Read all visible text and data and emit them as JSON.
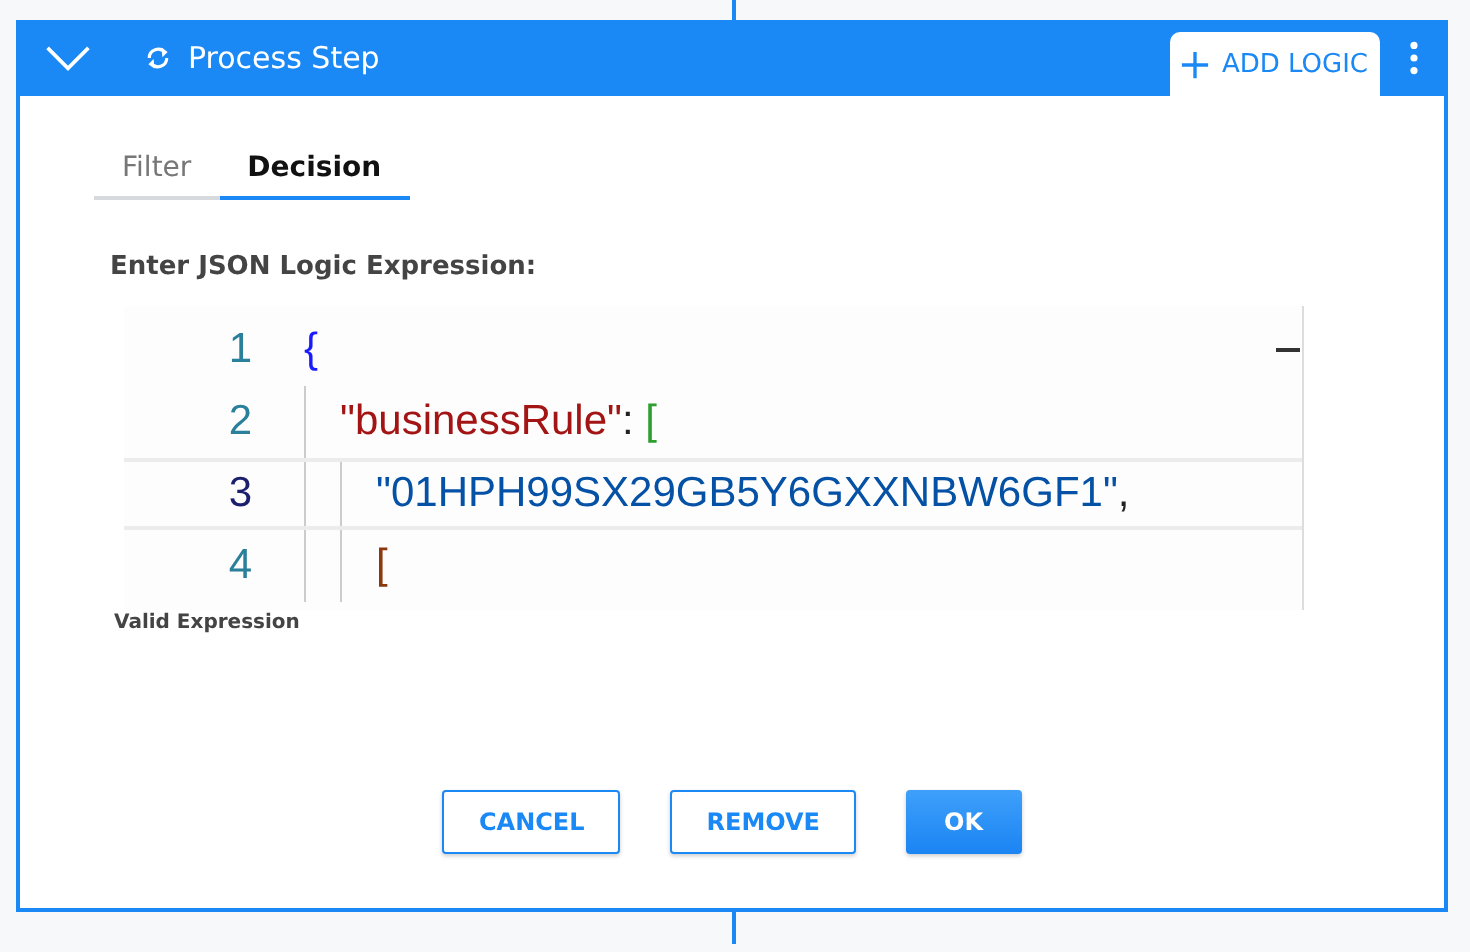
{
  "header": {
    "title": "Process Step",
    "expanded": true,
    "action": "ADD LOGIC"
  },
  "tabs": [
    {
      "label": "Filter",
      "selected": false
    },
    {
      "label": "Decision",
      "selected": true
    }
  ],
  "editor": {
    "label": "Enter JSON Logic Expression:",
    "lines": [
      {
        "number": "1",
        "current": false,
        "tokens": [
          {
            "text": "{",
            "kind": "brace"
          }
        ],
        "children": [
          {
            "number": "2",
            "current": false,
            "tokens": [
              {
                "text": "\"businessRule\"",
                "kind": "key"
              },
              {
                "text": ": ",
                "kind": "punct"
              },
              {
                "text": "[",
                "kind": "bracket"
              }
            ],
            "children": [
              {
                "number": "3",
                "current": true,
                "tokens": [
                  {
                    "text": "\"01HPH99SX29GB5Y6GXXNBW6GF1\"",
                    "kind": "string"
                  },
                  {
                    "text": ",",
                    "kind": "punct"
                  }
                ]
              },
              {
                "number": "4",
                "current": false,
                "tokens": [
                  {
                    "text": "[",
                    "kind": "bracket2"
                  }
                ]
              }
            ]
          }
        ]
      }
    ],
    "status": "Valid Expression"
  },
  "buttons": [
    {
      "label": "CANCEL",
      "kind": "outline"
    },
    {
      "label": "REMOVE",
      "kind": "outline"
    },
    {
      "label": "OK",
      "kind": "primary"
    }
  ]
}
